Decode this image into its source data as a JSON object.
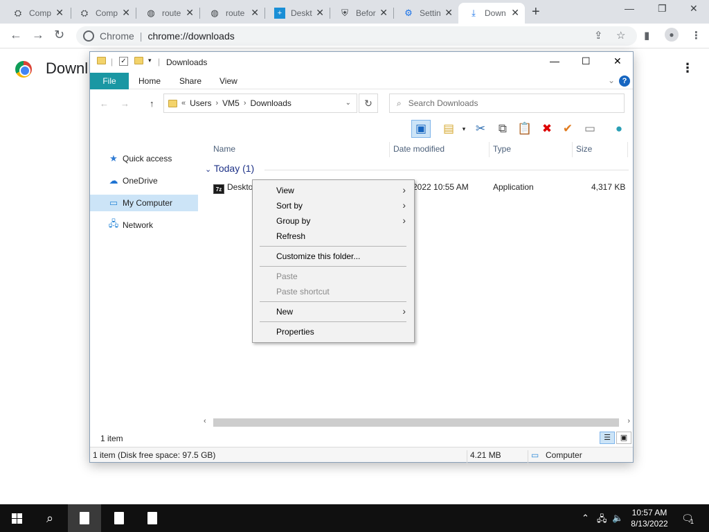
{
  "browser": {
    "tabs": [
      {
        "label": "Comp",
        "icon": "puzzle-icon"
      },
      {
        "label": "Comp",
        "icon": "puzzle-icon"
      },
      {
        "label": "route",
        "icon": "globe-icon"
      },
      {
        "label": "route",
        "icon": "globe-icon"
      },
      {
        "label": "Deskt",
        "icon": "plus-box-icon"
      },
      {
        "label": "Befor",
        "icon": "shield-icon"
      },
      {
        "label": "Settin",
        "icon": "gear-icon"
      },
      {
        "label": "Down",
        "icon": "download-icon"
      }
    ],
    "site_name": "Chrome",
    "url": "chrome://downloads",
    "page_title": "Downl"
  },
  "explorer": {
    "title": "Downloads",
    "ribbon_tabs": [
      "File",
      "Home",
      "Share",
      "View"
    ],
    "breadcrumb": {
      "prefix": "«",
      "parts": [
        "Users",
        "VM5",
        "Downloads"
      ]
    },
    "search_placeholder": "Search Downloads",
    "nav_items": [
      {
        "label": "Quick access",
        "icon": "star-icon"
      },
      {
        "label": "OneDrive",
        "icon": "cloud-icon"
      },
      {
        "label": "My Computer",
        "icon": "computer-icon",
        "selected": true
      },
      {
        "label": "Network",
        "icon": "network-icon"
      }
    ],
    "columns": [
      "Name",
      "Date modified",
      "Type",
      "Size"
    ],
    "group_label": "Today (1)",
    "file": {
      "name": "Deskto",
      "date": "2022 10:55 AM",
      "type": "Application",
      "size": "4,317 KB"
    },
    "item_count": "1 item",
    "status": {
      "left": "1 item (Disk free space: 97.5 GB)",
      "size": "4.21 MB",
      "location": "Computer"
    }
  },
  "context_menu": {
    "items": [
      {
        "label": "View",
        "submenu": true
      },
      {
        "label": "Sort by",
        "submenu": true
      },
      {
        "label": "Group by",
        "submenu": true
      },
      {
        "label": "Refresh"
      },
      {
        "label": "Customize this folder..."
      },
      {
        "label": "Paste",
        "disabled": true
      },
      {
        "label": "Paste shortcut",
        "disabled": true
      },
      {
        "label": "New",
        "submenu": true
      },
      {
        "label": "Properties"
      }
    ]
  },
  "taskbar": {
    "time": "10:57 AM",
    "date": "8/13/2022",
    "notification_count": "1"
  }
}
